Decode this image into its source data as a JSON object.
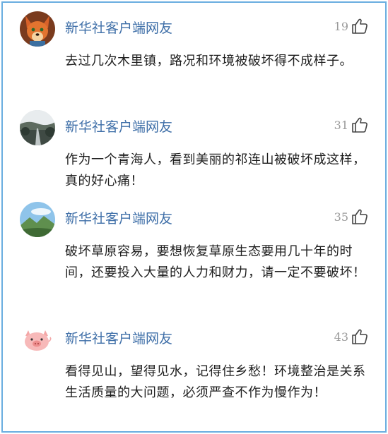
{
  "comments": [
    {
      "avatar_icon": "fox-avatar-icon",
      "username": "新华社客户端网友",
      "likes": "19",
      "like_icon": "thumbs-up-icon",
      "text": "去过几次木里镇，路况和环境被破坏得不成样子。"
    },
    {
      "avatar_icon": "road-landscape-avatar-icon",
      "username": "新华社客户端网友",
      "likes": "31",
      "like_icon": "thumbs-up-icon",
      "text": "作为一个青海人，看到美丽的祁连山被破坏成这样，真的好心痛！"
    },
    {
      "avatar_icon": "mountain-sky-avatar-icon",
      "username": "新华社客户端网友",
      "likes": "35",
      "like_icon": "thumbs-up-icon",
      "text": "破坏草原容易，要想恢复草原生态要用几十年的时间，还要投入大量的人力和财力，请一定不要破坏！"
    },
    {
      "avatar_icon": "pig-avatar-icon",
      "username": "新华社客户端网友",
      "likes": "43",
      "like_icon": "thumbs-up-icon",
      "text": "看得见山，望得见水，记得住乡愁！环境整治是关系生活质量的大问题，必须严查不作为慢作为！"
    }
  ],
  "colors": {
    "border": "#6aaee0",
    "username": "#3f6fa8",
    "like_count": "#9a9a9a",
    "text": "#1e1e1e"
  }
}
